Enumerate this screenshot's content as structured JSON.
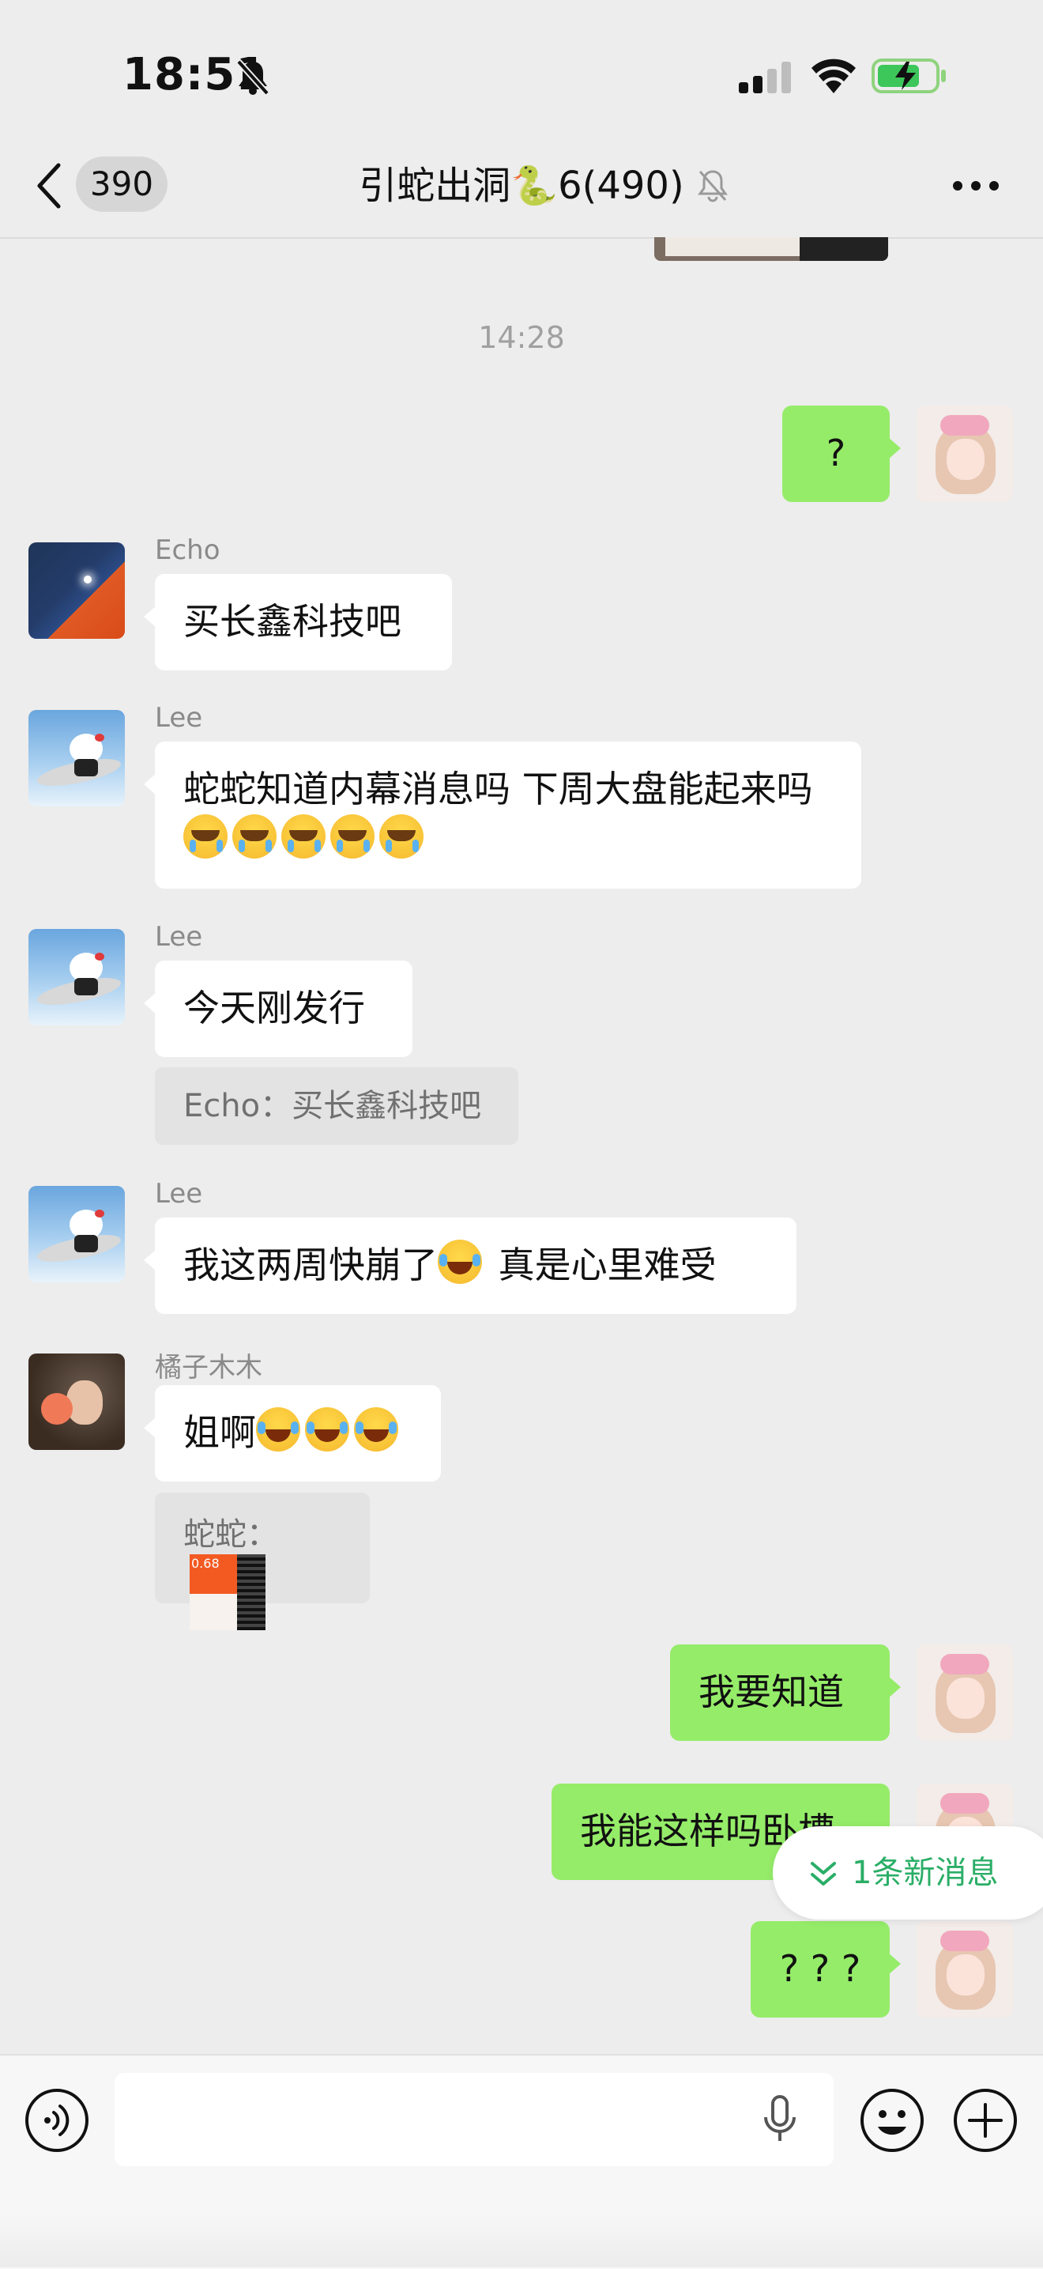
{
  "status_bar": {
    "time": "18:51"
  },
  "header": {
    "unread_count": "390",
    "title": "引蛇出洞🐍6(490)"
  },
  "timestamp": "14:28",
  "messages": [
    {
      "from": "me",
      "text": "?"
    },
    {
      "from": "Echo",
      "sender": "Echo",
      "text": "买长鑫科技吧"
    },
    {
      "from": "Lee",
      "sender": "Lee",
      "text": "蛇蛇知道内幕消息吗 下周大盘能起来吗"
    },
    {
      "from": "Lee",
      "sender": "Lee",
      "text": "今天刚发行",
      "quote": "Echo：买长鑫科技吧"
    },
    {
      "from": "Lee",
      "sender": "Lee",
      "text_a": "我这两周快崩了",
      "text_b": " 真是心里难受"
    },
    {
      "from": "橘子木木",
      "sender": "橘子木木",
      "text": "姐啊",
      "quote": "蛇蛇："
    },
    {
      "from": "me",
      "text": "我要知道"
    },
    {
      "from": "me",
      "text": "我能这样吗卧槽"
    },
    {
      "from": "me",
      "text": "? ? ?"
    }
  ],
  "quote_thumb_number": "0.68",
  "new_message_pill": "1条新消息",
  "colors": {
    "outgoing_bubble": "#95ec69",
    "background": "#ededed",
    "accent_green": "#2aae67"
  }
}
